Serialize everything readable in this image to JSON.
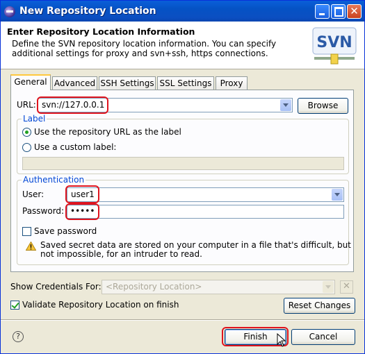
{
  "window": {
    "title": "New Repository Location",
    "controls": {
      "minimize": "minimize-icon",
      "maximize": "maximize-icon",
      "close": "close-icon"
    }
  },
  "header": {
    "title": "Enter Repository Location Information",
    "description": "Define the SVN repository location information. You can specify additional settings for proxy and svn+ssh, https connections.",
    "logo_text": "SVN"
  },
  "tabs": [
    {
      "label": "General",
      "active": true
    },
    {
      "label": "Advanced"
    },
    {
      "label": "SSH Settings"
    },
    {
      "label": "SSL Settings"
    },
    {
      "label": "Proxy"
    }
  ],
  "general": {
    "url_label": "URL:",
    "url_value": "svn://127.0.0.1",
    "browse_label": "Browse",
    "label_group": {
      "title": "Label",
      "option_repo_url": "Use the repository URL as the label",
      "option_custom": "Use a custom label:",
      "selected": "repo_url",
      "custom_value": ""
    },
    "auth_group": {
      "title": "Authentication",
      "user_label": "User:",
      "user_value": "user1",
      "password_label": "Password:",
      "password_value": "•••••",
      "save_password_label": "Save password",
      "save_password_checked": false,
      "warning_line1": "Saved secret data are stored on your computer in a file that's difficult, but",
      "warning_line2": "not impossible, for an intruder to read."
    }
  },
  "credentials": {
    "label": "Show Credentials For:",
    "placeholder": "<Repository Location>"
  },
  "validate": {
    "label": "Validate Repository Location on finish",
    "checked": true
  },
  "buttons": {
    "reset": "Reset Changes",
    "finish": "Finish",
    "cancel": "Cancel"
  },
  "colors": {
    "title_bar": "#0553c5",
    "group_title": "#0046d5",
    "highlight": "#e0141e",
    "check_mark": "#21a121"
  }
}
